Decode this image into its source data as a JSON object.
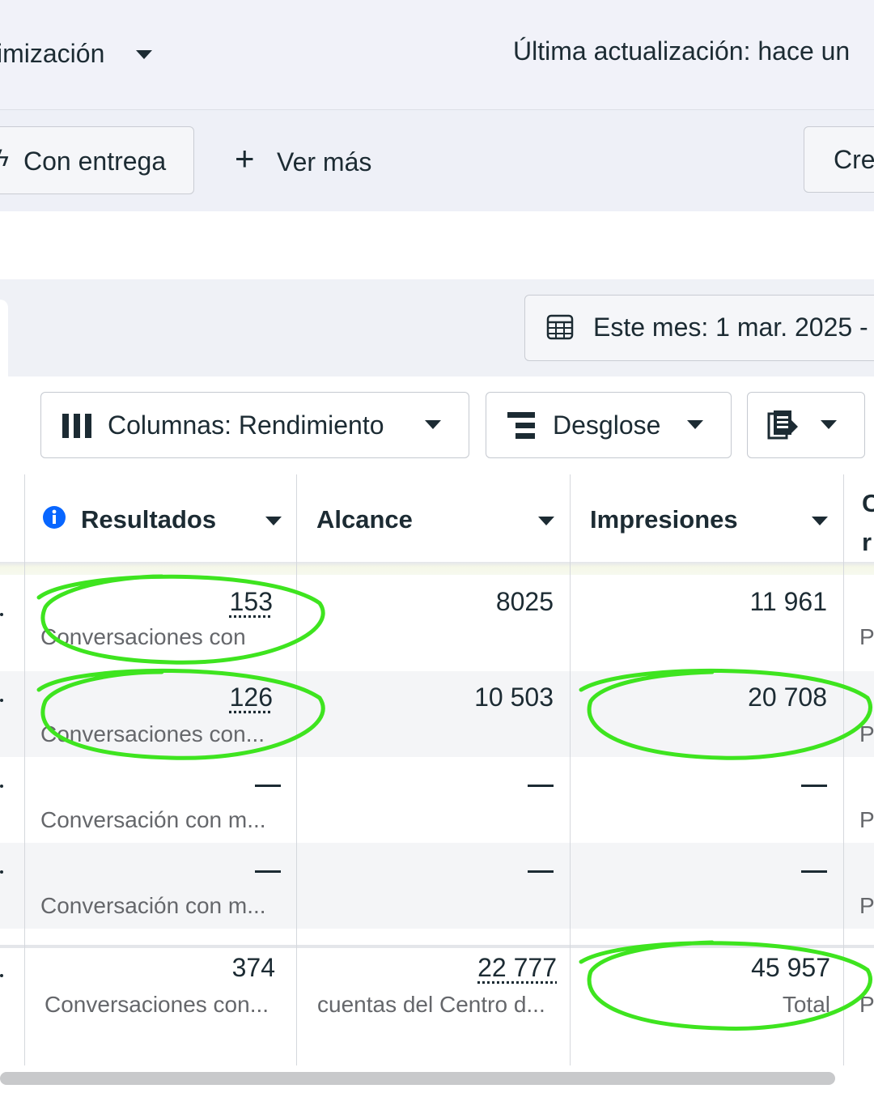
{
  "header": {
    "optimization_label": "imización",
    "last_update": "Última actualización: hace un"
  },
  "filters": {
    "delivery_chip": "Con entrega",
    "see_more": "Ver más",
    "create_label": "Cre"
  },
  "date_picker": {
    "label": "Este mes: 1 mar. 2025 -"
  },
  "toolbar": {
    "columns": "Columnas: Rendimiento",
    "breakdown": "Desglose"
  },
  "table": {
    "headers": {
      "results": "Resultados",
      "reach": "Alcance",
      "impressions": "Impresiones",
      "next_col_top": "C",
      "next_col_bottom": "r"
    },
    "rows": [
      {
        "results": "153",
        "results_sub": "Conversaciones con",
        "reach": "8025",
        "impressions": "11 961",
        "edge": "P"
      },
      {
        "results": "126",
        "results_sub": "Conversaciones con...",
        "reach": "10 503",
        "impressions": "20 708",
        "edge": "P"
      },
      {
        "results": "—",
        "results_sub": "Conversación con m...",
        "reach": "—",
        "impressions": "—",
        "edge": "P"
      },
      {
        "results": "—",
        "results_sub": "Conversación con m...",
        "reach": "—",
        "impressions": "—",
        "edge": "P"
      }
    ],
    "totals": {
      "results": "374",
      "results_sub": "Conversaciones con...",
      "reach": "22 777",
      "reach_sub": "cuentas del Centro d...",
      "impressions": "45 957",
      "impressions_sub": "Total",
      "edge": "P"
    }
  },
  "annotation_color": "#3ee41f",
  "accent_color": "#0866ff"
}
